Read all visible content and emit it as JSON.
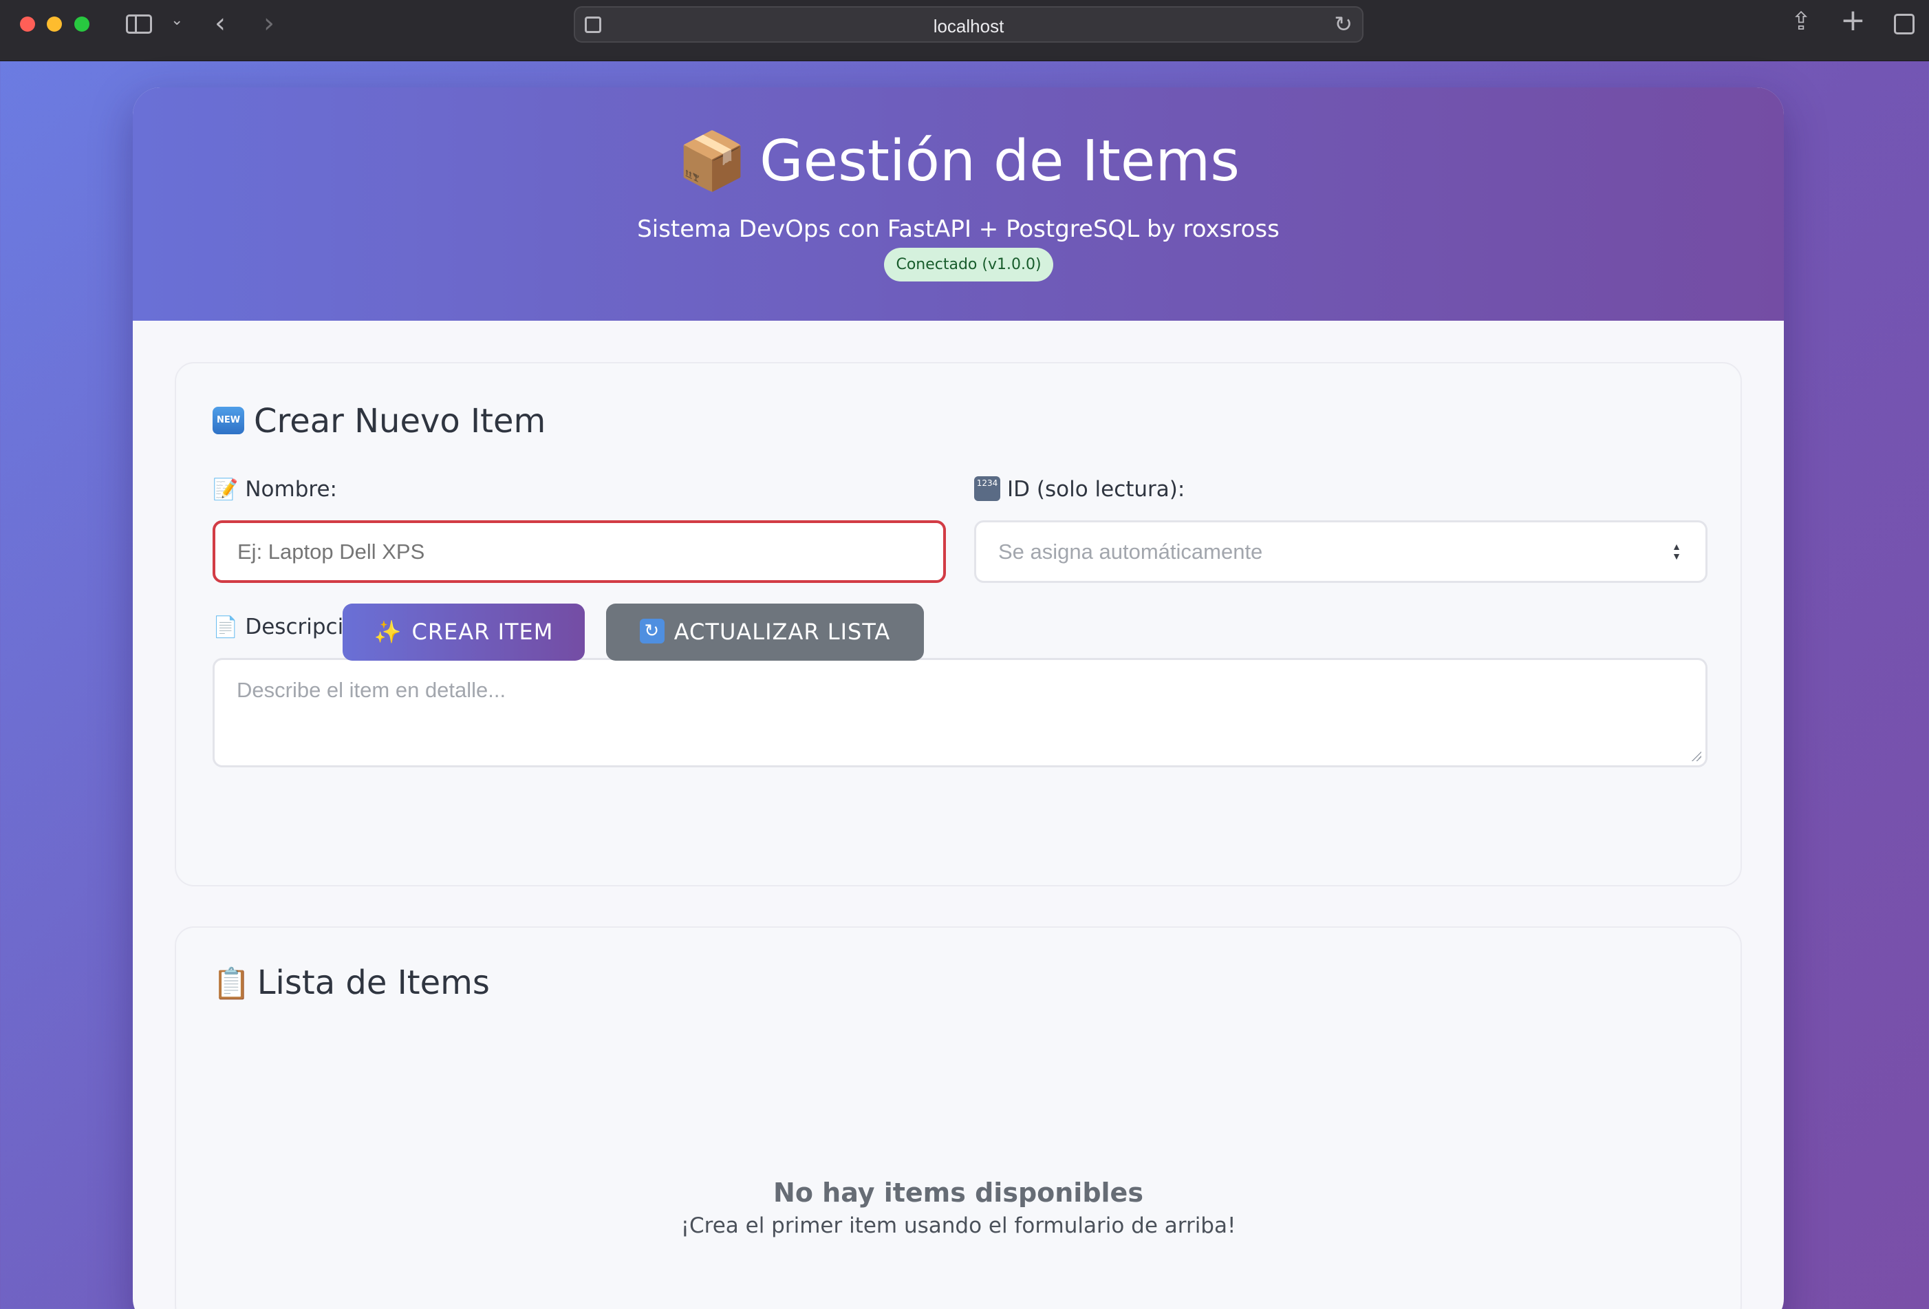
{
  "browser": {
    "url": "localhost"
  },
  "hero": {
    "icon": "📦",
    "title": "Gestión de Items",
    "subtitle": "Sistema DevOps con FastAPI + PostgreSQL by roxsross",
    "status_badge": "Conectado (v1.0.0)"
  },
  "create_section": {
    "icon": "NEW",
    "title": "Crear Nuevo Item",
    "name_icon": "📝",
    "name_label": "Nombre:",
    "name_placeholder": "Ej: Laptop Dell XPS",
    "name_value": "",
    "id_icon": "1234",
    "id_label": "ID (solo lectura):",
    "id_placeholder": "Se asigna automáticamente",
    "desc_icon": "📄",
    "desc_label": "Descripción:",
    "desc_placeholder": "Describe el item en detalle...",
    "create_button_icon": "✨",
    "create_button": "CREAR ITEM",
    "refresh_button_icon": "🔄",
    "refresh_button": "ACTUALIZAR LISTA"
  },
  "list_section": {
    "icon": "📋",
    "title": "Lista de Items",
    "empty_title": "No hay items disponibles",
    "empty_text": "¡Crea el primer item usando el formulario de arriba!"
  },
  "colors": {
    "accent_start": "#6a70d6",
    "accent_end": "#744da4",
    "error_border": "#d23c45",
    "badge_bg": "#d5f1dd",
    "secondary_button": "#6e757d"
  }
}
